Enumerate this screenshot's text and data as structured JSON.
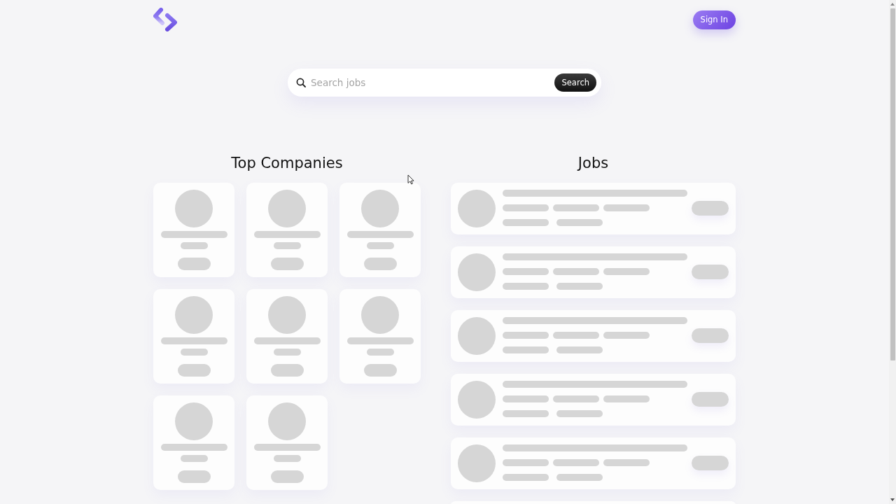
{
  "header": {
    "sign_in_button": "Sign In"
  },
  "search": {
    "placeholder": "Search jobs",
    "button": "Search"
  },
  "top_companies": {
    "title": "Top Companies",
    "cards": [
      {
        "kind": "skeleton"
      },
      {
        "kind": "skeleton"
      },
      {
        "kind": "skeleton"
      },
      {
        "kind": "skeleton"
      },
      {
        "kind": "skeleton"
      },
      {
        "kind": "skeleton"
      },
      {
        "kind": "skeleton"
      },
      {
        "kind": "skeleton"
      }
    ]
  },
  "jobs": {
    "title": "Jobs",
    "cards": [
      {
        "kind": "skeleton"
      },
      {
        "kind": "skeleton"
      },
      {
        "kind": "skeleton"
      },
      {
        "kind": "skeleton"
      },
      {
        "kind": "skeleton"
      },
      {
        "kind": "partial"
      }
    ]
  }
}
